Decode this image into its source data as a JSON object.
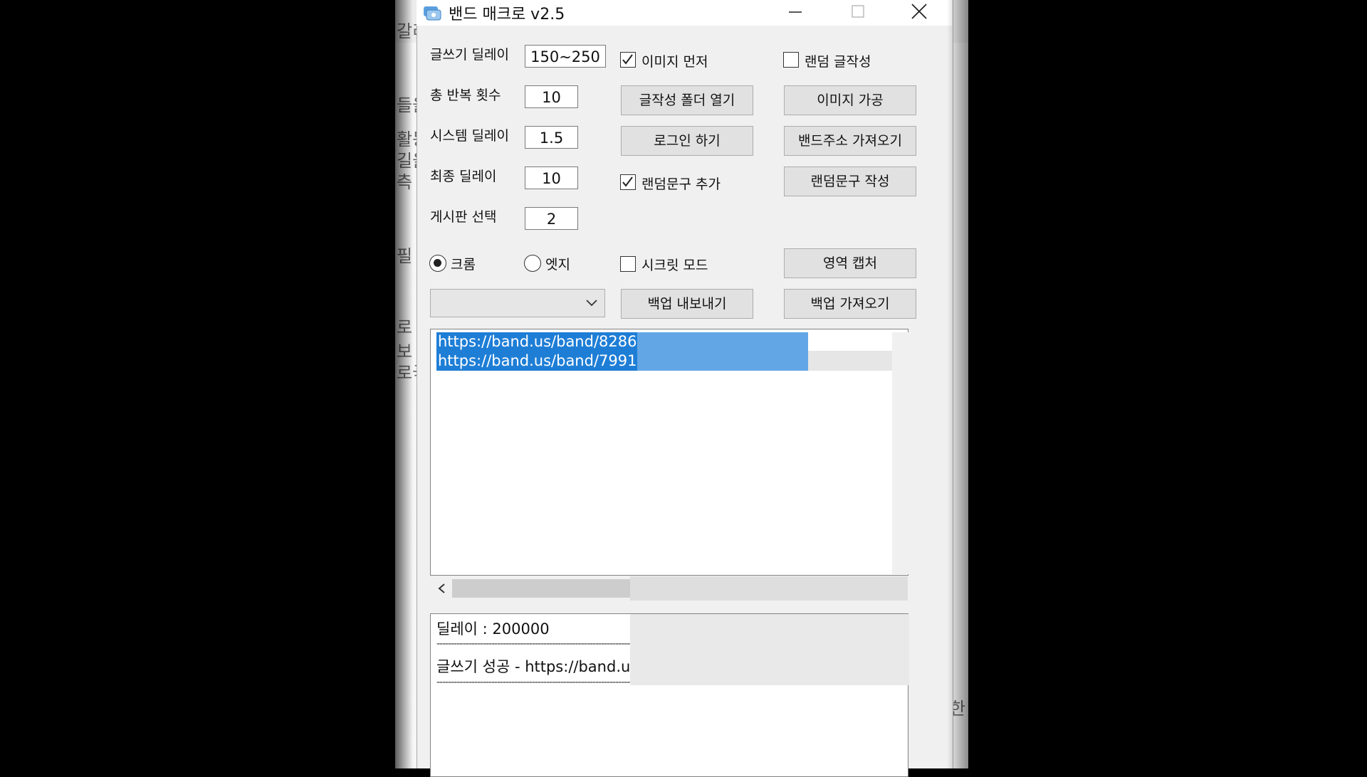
{
  "window": {
    "title": "밴드 매크로 v2.5"
  },
  "settings": {
    "write_delay_label": "글쓰기 딜레이",
    "write_delay_value": "150~250",
    "repeat_count_label": "총 반복 횟수",
    "repeat_count_value": "10",
    "system_delay_label": "시스템 딜레이",
    "system_delay_value": "1.5",
    "final_delay_label": "최종 딜레이",
    "final_delay_value": "10",
    "board_select_label": "게시판 선택",
    "board_select_value": "2"
  },
  "checks": {
    "image_first": {
      "label": "이미지 먼저",
      "checked": true
    },
    "random_write": {
      "label": "랜덤 글작성",
      "checked": false
    },
    "random_phrase": {
      "label": "랜덤문구 추가",
      "checked": true
    },
    "secret_mode": {
      "label": "시크릿 모드",
      "checked": false
    }
  },
  "buttons": {
    "open_folder": "글작성 폴더 열기",
    "image_process": "이미지 가공",
    "login": "로그인 하기",
    "fetch_band": "밴드주소 가져오기",
    "random_phrase_write": "랜덤문구 작성",
    "area_capture": "영역 캡처",
    "backup_export": "백업 내보내기",
    "backup_import": "백업 가져오기"
  },
  "browser": {
    "chrome": {
      "label": "크롬",
      "selected": true
    },
    "edge": {
      "label": "엣지",
      "selected": false
    }
  },
  "dropdown": {
    "value": ""
  },
  "urls": [
    "https://band.us/band/8286",
    "https://band.us/band/7991"
  ],
  "log": {
    "delay": "딜레이 : 200000",
    "separator": "--------------------------------------------------------------------------------------------------------",
    "write_success": "글쓰기 성공 - https://band.u"
  },
  "background": {
    "glyphs": [
      "갈리",
      "들을",
      "활동",
      "길을",
      "측",
      "필",
      "로",
      "보",
      "로국",
      "한"
    ]
  }
}
